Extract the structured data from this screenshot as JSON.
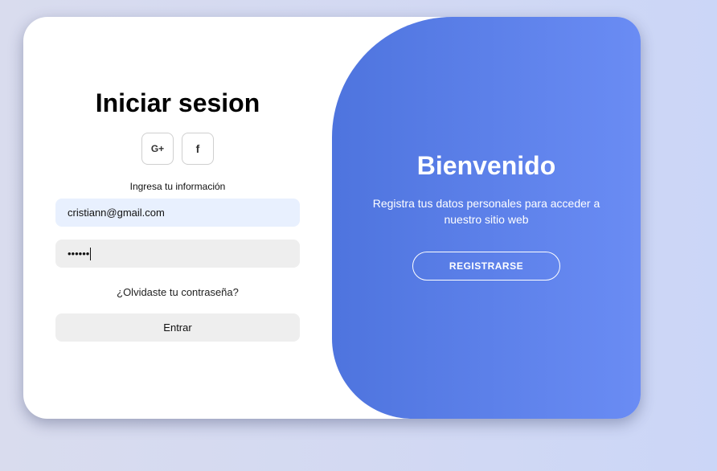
{
  "login": {
    "title": "Iniciar sesion",
    "social": [
      {
        "label": "G+",
        "icon": "google-plus-icon"
      },
      {
        "label": "f",
        "icon": "facebook-icon"
      }
    ],
    "hint": "Ingresa tu información",
    "email_value": "cristiann@gmail.com",
    "password_masked": "••••••",
    "forgot_link": "¿Olvidaste tu contraseña?",
    "submit_label": "Entrar"
  },
  "welcome": {
    "title": "Bienvenido",
    "text": "Registra tus datos personales para acceder a nuestro sitio web",
    "register_label": "REGISTRARSE"
  },
  "colors": {
    "panel_gradient_start": "#4e74de",
    "panel_gradient_end": "#6a8cf4",
    "email_bg": "#e8f0fe",
    "input_bg": "#eeeeee"
  }
}
